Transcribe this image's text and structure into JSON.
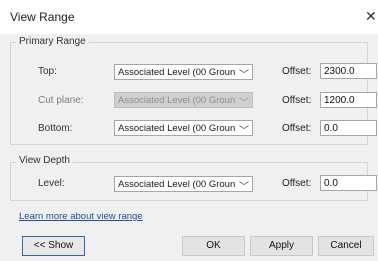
{
  "window": {
    "title": "View Range",
    "close_label": "✕"
  },
  "primary_range": {
    "title": "Primary Range",
    "rows": [
      {
        "label": "Top:",
        "level": "Associated Level (00 Groun",
        "offset_label": "Offset:",
        "offset_value": "2300.0",
        "disabled": false
      },
      {
        "label": "Cut plane:",
        "level": "Associated Level (00 Groun",
        "offset_label": "Offset:",
        "offset_value": "1200.0",
        "disabled": true
      },
      {
        "label": "Bottom:",
        "level": "Associated Level (00 Groun",
        "offset_label": "Offset:",
        "offset_value": "0.0",
        "disabled": false
      }
    ]
  },
  "view_depth": {
    "title": "View Depth",
    "rows": [
      {
        "label": "Level:",
        "level": "Associated Level (00 Groun",
        "offset_label": "Offset:",
        "offset_value": "0.0",
        "disabled": false
      }
    ]
  },
  "link": {
    "text": "Learn more about view range"
  },
  "buttons": {
    "show": "<< Show",
    "ok": "OK",
    "apply": "Apply",
    "cancel": "Cancel"
  },
  "icons": {
    "dropdown": "chevron-down-icon",
    "close": "close-icon"
  }
}
